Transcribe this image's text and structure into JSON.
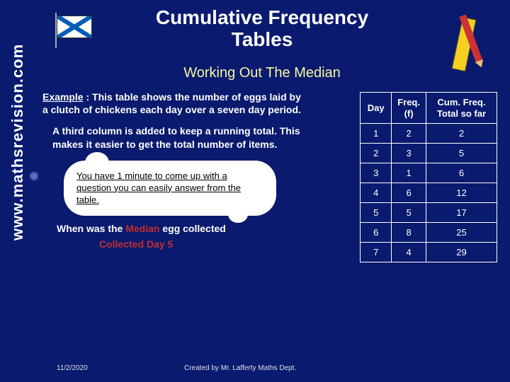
{
  "title": "Cumulative Frequency Tables",
  "subtitle": "Working Out The Median",
  "vertical_url": "www.mathsrevision.com",
  "example_label": "Example",
  "example_body": " : This table shows the number of eggs laid by a clutch of chickens each day over a seven day period.",
  "second_text": "A third column is added to keep a running total. This makes it easier to get the total number of items.",
  "cloud_text": "You have 1 minute to come up with a question you can easily answer from the table.",
  "q1_a": "When was the ",
  "q1_b": "Median ",
  "q1_c": "egg collected",
  "q2": "Collected Day 5",
  "table": {
    "headers": [
      "Day",
      "Freq. (f)",
      "Cum. Freq. Total so far"
    ],
    "rows": [
      [
        "1",
        "2",
        "2"
      ],
      [
        "2",
        "3",
        "5"
      ],
      [
        "3",
        "1",
        "6"
      ],
      [
        "4",
        "6",
        "12"
      ],
      [
        "5",
        "5",
        "17"
      ],
      [
        "6",
        "8",
        "25"
      ],
      [
        "7",
        "4",
        "29"
      ]
    ]
  },
  "footer": {
    "date": "11/2/2020",
    "credit": "Created by Mr. Lafferty Maths Dept."
  }
}
